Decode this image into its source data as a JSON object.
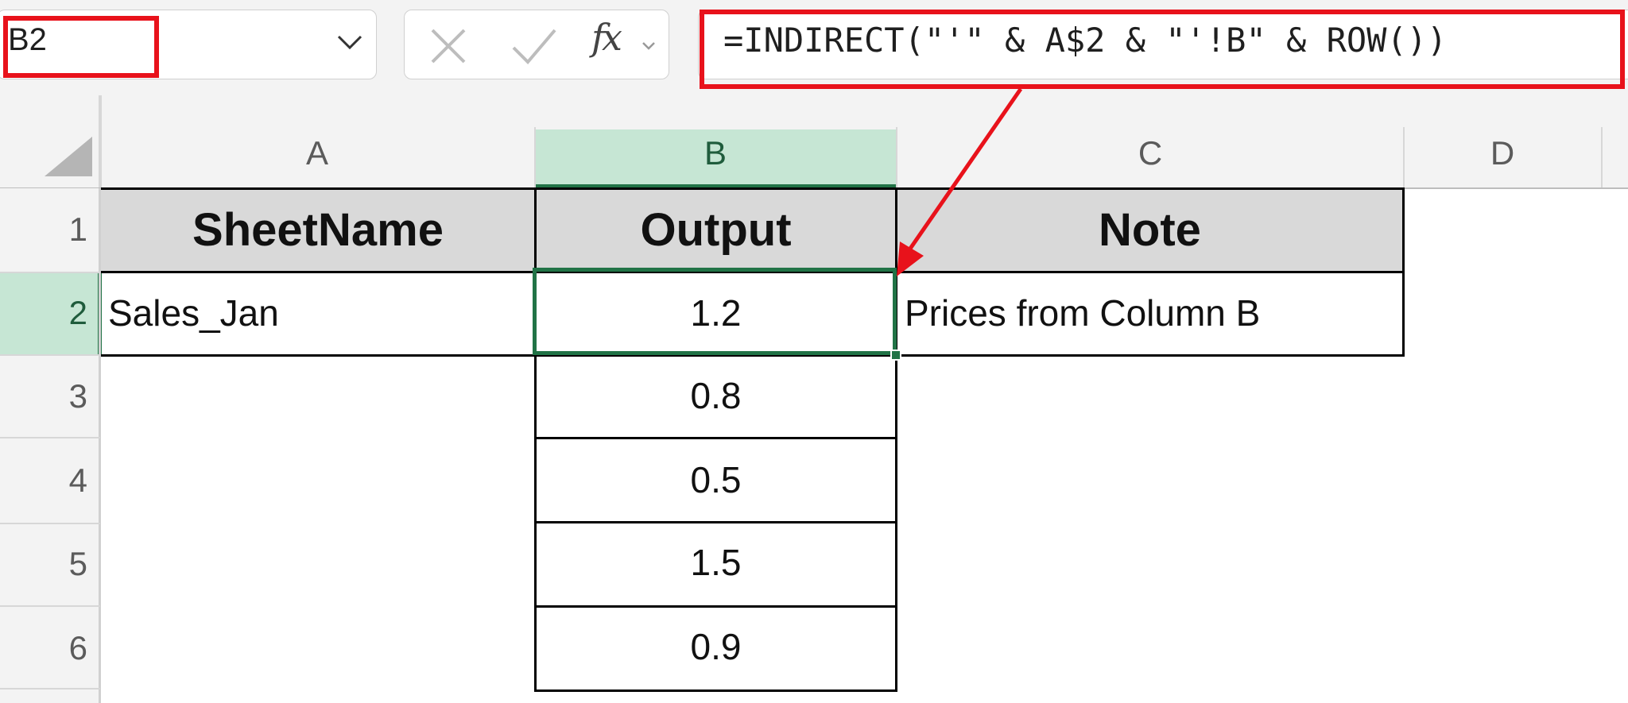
{
  "name_box": {
    "value": "B2"
  },
  "formula_bar": {
    "cancel_icon": "close-icon",
    "enter_icon": "check-icon",
    "fx_label": "fx",
    "formula": "=INDIRECT(\"'\" & A$2 & \"'!B\" & ROW())"
  },
  "columns": [
    "A",
    "B",
    "C",
    "D"
  ],
  "rows": [
    "1",
    "2",
    "3",
    "4",
    "5",
    "6"
  ],
  "cells": {
    "A1": "SheetName",
    "B1": "Output",
    "C1": "Note",
    "A2": "Sales_Jan",
    "B2": "1.2",
    "C2": "Prices from Column B",
    "B3": "0.8",
    "B4": "0.5",
    "B5": "1.5",
    "B6": "0.9"
  },
  "selection": {
    "cell": "B2",
    "column": "B",
    "row": "2"
  },
  "colors": {
    "selection_accent": "#217346",
    "selection_header_fill": "#c6e6d4",
    "header_row_fill": "#d9d9d9",
    "annotation_red": "#e8121b"
  }
}
